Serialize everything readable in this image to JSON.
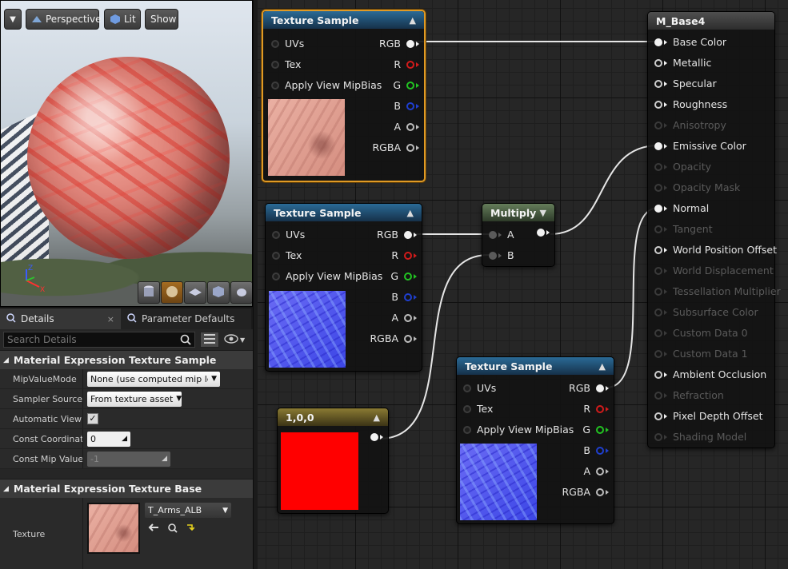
{
  "viewport": {
    "toolbar": {
      "perspective": "Perspective",
      "lit": "Lit",
      "show": "Show"
    },
    "axis": {
      "z": "Z",
      "x": "X"
    }
  },
  "details": {
    "tabs": [
      {
        "label": "Details",
        "close": "×"
      },
      {
        "label": "Parameter Defaults"
      }
    ],
    "search_placeholder": "Search Details",
    "sections": [
      {
        "title": "Material Expression Texture Sample",
        "rows": [
          {
            "label": "MipValueMode",
            "value": "None (use computed mip lev"
          },
          {
            "label": "Sampler Source",
            "value": "From texture asset"
          },
          {
            "label": "Automatic View M",
            "value": "✓"
          },
          {
            "label": "Const Coordinate",
            "value": "0"
          },
          {
            "label": "Const Mip Value",
            "value": "-1"
          }
        ]
      },
      {
        "title": "Material Expression Texture Base",
        "rows": [
          {
            "label": "Texture",
            "value": "T_Arms_ALB"
          }
        ]
      }
    ]
  },
  "graph": {
    "texture_sample_1": {
      "title": "Texture Sample",
      "inputs": [
        "UVs",
        "Tex",
        "Apply View MipBias"
      ],
      "outputs": [
        "RGB",
        "R",
        "G",
        "B",
        "A",
        "RGBA"
      ]
    },
    "texture_sample_2": {
      "title": "Texture Sample",
      "inputs": [
        "UVs",
        "Tex",
        "Apply View MipBias"
      ],
      "outputs": [
        "RGB",
        "R",
        "G",
        "B",
        "A",
        "RGBA"
      ]
    },
    "texture_sample_3": {
      "title": "Texture Sample",
      "inputs": [
        "UVs",
        "Tex",
        "Apply View MipBias"
      ],
      "outputs": [
        "RGB",
        "R",
        "G",
        "B",
        "A",
        "RGBA"
      ]
    },
    "multiply": {
      "title": "Multiply",
      "inputs": [
        "A",
        "B"
      ]
    },
    "constant": {
      "title": "1,0,0"
    },
    "material": {
      "title": "M_Base4",
      "pins": [
        {
          "label": "Base Color",
          "enabled": true
        },
        {
          "label": "Metallic",
          "enabled": true
        },
        {
          "label": "Specular",
          "enabled": true
        },
        {
          "label": "Roughness",
          "enabled": true
        },
        {
          "label": "Anisotropy",
          "enabled": false
        },
        {
          "label": "Emissive Color",
          "enabled": true
        },
        {
          "label": "Opacity",
          "enabled": false
        },
        {
          "label": "Opacity Mask",
          "enabled": false
        },
        {
          "label": "Normal",
          "enabled": true
        },
        {
          "label": "Tangent",
          "enabled": false
        },
        {
          "label": "World Position Offset",
          "enabled": true
        },
        {
          "label": "World Displacement",
          "enabled": false
        },
        {
          "label": "Tessellation Multiplier",
          "enabled": false
        },
        {
          "label": "Subsurface Color",
          "enabled": false
        },
        {
          "label": "Custom Data 0",
          "enabled": false
        },
        {
          "label": "Custom Data 1",
          "enabled": false
        },
        {
          "label": "Ambient Occlusion",
          "enabled": true
        },
        {
          "label": "Refraction",
          "enabled": false
        },
        {
          "label": "Pixel Depth Offset",
          "enabled": true
        },
        {
          "label": "Shading Model",
          "enabled": false
        }
      ]
    }
  }
}
